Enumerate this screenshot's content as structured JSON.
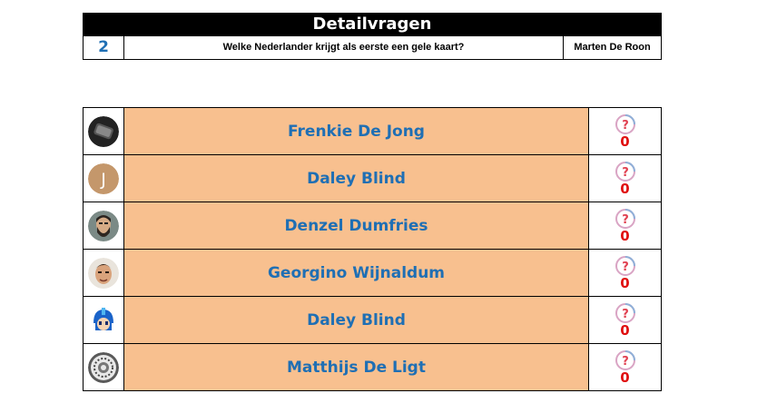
{
  "header": {
    "title": "Detailvragen",
    "question_number": "2",
    "question_text": "Welke Nederlander krijgt als eerste een gele kaart?",
    "author": "Marten De Roon"
  },
  "answers": [
    {
      "name": "Frenkie De Jong",
      "score": "0",
      "avatar": "phone-avatar",
      "status_icon": "question-mark-icon"
    },
    {
      "name": "Daley Blind",
      "score": "0",
      "avatar": "letter-j-avatar",
      "avatar_letter": "J",
      "status_icon": "question-mark-icon"
    },
    {
      "name": "Denzel Dumfries",
      "score": "0",
      "avatar": "bearded-man-photo-avatar",
      "status_icon": "question-mark-icon"
    },
    {
      "name": "Georgino Wijnaldum",
      "score": "0",
      "avatar": "man-photo-avatar",
      "status_icon": "question-mark-icon"
    },
    {
      "name": "Daley Blind",
      "score": "0",
      "avatar": "megaman-avatar",
      "status_icon": "question-mark-icon"
    },
    {
      "name": "Matthijs De Ligt",
      "score": "0",
      "avatar": "emblem-avatar",
      "status_icon": "question-mark-icon"
    }
  ],
  "colors": {
    "name_cell_background": "#f8c08f",
    "name_text": "#1f6fb4",
    "score_text": "#e01010",
    "header_background": "#000000"
  }
}
